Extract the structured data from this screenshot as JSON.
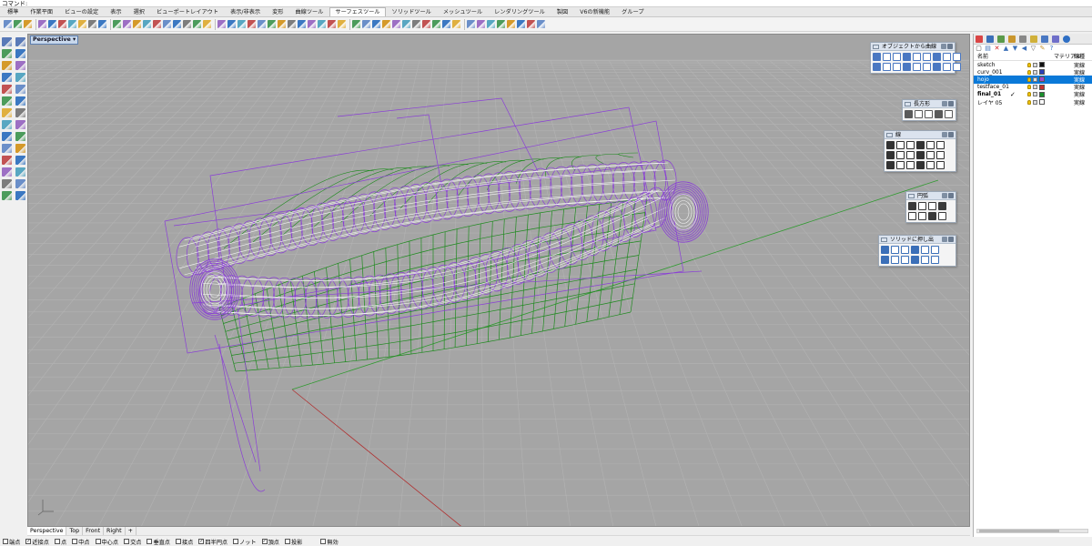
{
  "command": {
    "label": "コマンド:"
  },
  "tabs": [
    "標準",
    "作業平面",
    "ビューの設定",
    "表示",
    "選択",
    "ビューポートレイアウト",
    "表示/非表示",
    "変形",
    "曲線ツール",
    "サーフェスツール",
    "ソリッドツール",
    "メッシュツール",
    "レンダリングツール",
    "製図",
    "V6の新機能",
    "グループ"
  ],
  "active_tab_index": 9,
  "toolbar_icon_colors": [
    "#6b8fc9",
    "#4c9c5c",
    "#d59a2a",
    "#9d6fc4",
    "#3b78c2",
    "#c25252",
    "#58a7c2",
    "#e0b040",
    "#7d7d7d",
    "#3b78c2",
    "#4c9c5c",
    "#9d6fc4",
    "#d59a2a",
    "#58a7c2",
    "#c25252",
    "#6b8fc9",
    "#3b78c2",
    "#7d7d7d",
    "#4c9c5c",
    "#e0b040",
    "#9d6fc4",
    "#3b78c2",
    "#58a7c2",
    "#c25252",
    "#6b8fc9",
    "#4c9c5c",
    "#d59a2a",
    "#7d7d7d",
    "#3b78c2",
    "#9d6fc4",
    "#58a7c2",
    "#c25252",
    "#e0b040",
    "#4c9c5c",
    "#6b8fc9",
    "#3b78c2",
    "#d59a2a",
    "#9d6fc4",
    "#58a7c2",
    "#7d7d7d",
    "#c25252",
    "#4c9c5c",
    "#3b78c2",
    "#e0b040",
    "#6b8fc9",
    "#9d6fc4",
    "#58a7c2",
    "#4c9c5c",
    "#d59a2a",
    "#3b78c2",
    "#c25252",
    "#6b8fc9"
  ],
  "left_icon_colors": [
    "#5a7ab8",
    "#5a7ab8",
    "#4c9c5c",
    "#3b78c2",
    "#d59a2a",
    "#9d6fc4",
    "#3b78c2",
    "#58a7c2",
    "#c25252",
    "#6b8fc9",
    "#4c9c5c",
    "#3b78c2",
    "#e0b040",
    "#7d7d7d",
    "#58a7c2",
    "#9d6fc4",
    "#3b78c2",
    "#4c9c5c",
    "#6b8fc9",
    "#d59a2a",
    "#c25252",
    "#3b78c2",
    "#9d6fc4",
    "#58a7c2",
    "#7d7d7d",
    "#6b8fc9",
    "#4c9c5c",
    "#3b78c2"
  ],
  "viewport": {
    "title": "Perspective",
    "tabs": [
      "Perspective",
      "Top",
      "Front",
      "Right"
    ],
    "active_tab_index": 0,
    "add_tab_glyph": "+"
  },
  "palettes": [
    {
      "title": "オブジェクトから曲線",
      "icons": 18,
      "cols": 9,
      "icon_color": "#4a78c2"
    },
    {
      "title": "長方形",
      "icons": 5,
      "cols": 5,
      "icon_color": "#5a5a5a"
    },
    {
      "title": "線",
      "icons": 18,
      "cols": 6,
      "icon_color": "#333333"
    },
    {
      "title": "円弧",
      "icons": 8,
      "cols": 4,
      "icon_color": "#3a3a3a"
    },
    {
      "title": "ソリッドに押し出",
      "icons": 12,
      "cols": 6,
      "icon_color": "#3b6fb8"
    }
  ],
  "layers": {
    "headers": {
      "name": "名前",
      "material": "マテリアル",
      "linetype": "線種"
    },
    "rows": [
      {
        "name": "sketch",
        "current": false,
        "color": "#111111",
        "linetype": "実線",
        "selected": false,
        "bold": false
      },
      {
        "name": "curv_001",
        "current": false,
        "color": "#2a3fb8",
        "linetype": "実線",
        "selected": false,
        "bold": false
      },
      {
        "name": "hojo",
        "current": false,
        "color": "#a347c8",
        "linetype": "実線",
        "selected": true,
        "bold": false
      },
      {
        "name": "testface_01",
        "current": false,
        "color": "#c43131",
        "linetype": "実線",
        "selected": false,
        "bold": false
      },
      {
        "name": "final_01",
        "current": true,
        "color": "#1a8f2c",
        "linetype": "実線",
        "selected": false,
        "bold": true
      },
      {
        "name": "レイヤ 05",
        "current": false,
        "color": "#ffffff",
        "linetype": "実線",
        "selected": false,
        "bold": false
      }
    ],
    "current_mark": "✓"
  },
  "osnap": [
    {
      "label": "端点",
      "checked": false
    },
    {
      "label": "近接点",
      "checked": true
    },
    {
      "label": "点",
      "checked": false
    },
    {
      "label": "中点",
      "checked": false
    },
    {
      "label": "中心点",
      "checked": false
    },
    {
      "label": "交点",
      "checked": false
    },
    {
      "label": "垂直点",
      "checked": false
    },
    {
      "label": "接点",
      "checked": false
    },
    {
      "label": "四半円点",
      "checked": true
    },
    {
      "label": "ノット",
      "checked": false
    },
    {
      "label": "頂点",
      "checked": true
    },
    {
      "label": "投影",
      "checked": false
    },
    {
      "label": "無効",
      "checked": false
    }
  ],
  "colors": {
    "wire_green": "#1f8a1f",
    "wire_purple": "#8a3fd6",
    "wire_white": "#f4f4f4",
    "grid": "#b3b3b3",
    "axis_red": "#b03030",
    "axis_green": "#2f9a2f",
    "viewport_bg": "#a5a5a5"
  }
}
